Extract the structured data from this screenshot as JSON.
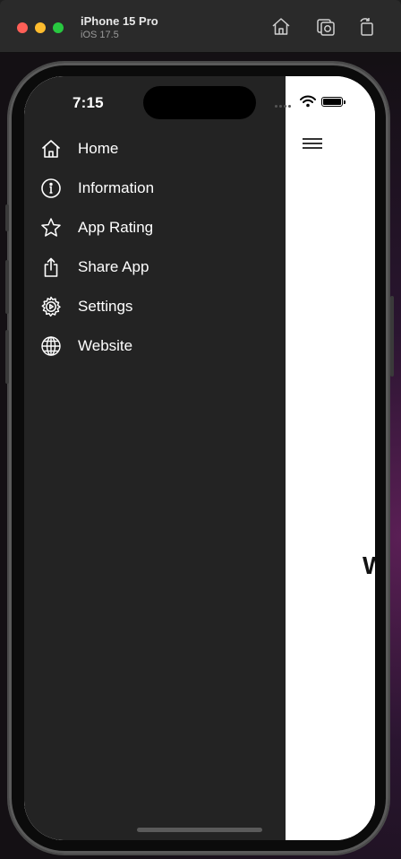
{
  "simulator": {
    "device_name": "iPhone 15 Pro",
    "os_version": "iOS 17.5",
    "buttons": [
      {
        "icon": "home-icon"
      },
      {
        "icon": "screenshot-icon"
      },
      {
        "icon": "rotate-icon"
      }
    ]
  },
  "status_bar": {
    "time": "7:15"
  },
  "drawer": {
    "items": [
      {
        "label": "Home",
        "icon": "home-icon"
      },
      {
        "label": "Information",
        "icon": "info-icon"
      },
      {
        "label": "App Rating",
        "icon": "star-icon"
      },
      {
        "label": "Share App",
        "icon": "share-icon"
      },
      {
        "label": "Settings",
        "icon": "gear-icon"
      },
      {
        "label": "Website",
        "icon": "globe-icon"
      }
    ]
  },
  "content": {
    "peek_text": "W"
  },
  "colors": {
    "drawer_bg": "#232323",
    "content_bg": "#ffffff",
    "traffic_red": "#ff5f57",
    "traffic_yellow": "#febc2e",
    "traffic_green": "#28c840"
  }
}
